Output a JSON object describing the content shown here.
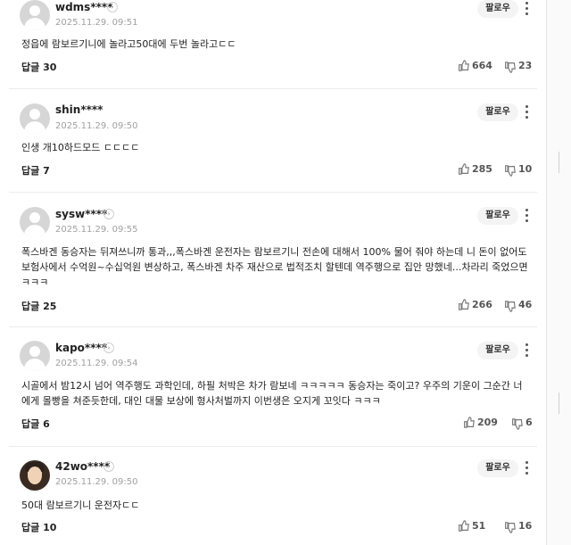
{
  "labels": {
    "follow": "팔로우",
    "reply_prefix": "답글"
  },
  "comments": [
    {
      "user": "wdms****",
      "date": "2025.11.29. 09:51",
      "avatar": "default-avatar",
      "text": "정읍에 람보르기니에 놀라고50대에 두번 놀라고ㄷㄷ",
      "replies": "30",
      "likes": "664",
      "dislikes": "23"
    },
    {
      "user": "shin****",
      "date": "2025.11.29. 09:50",
      "avatar": "default-avatar",
      "text": "인생 개10하드모드 ㄷㄷㄷㄷ",
      "replies": "7",
      "likes": "285",
      "dislikes": "10"
    },
    {
      "user": "sysw****",
      "date": "2025.11.29. 09:55",
      "avatar": "default-avatar",
      "text": "폭스바겐 동승자는 뒤져쓰니까 통과,,,폭스바겐 운전자는 람보르기니 전손에 대해서 100% 물어 줘야 하는데 니 돈이 없어도 보험사에서 수억원~수십억원 변상하고, 폭스바겐 차주 재산으로 법적조치 할텐데 역주행으로 집안 망했네...차라리 죽었으면 ㅋㅋㅋ",
      "replies": "25",
      "likes": "266",
      "dislikes": "46"
    },
    {
      "user": "kapo****",
      "date": "2025.11.29. 09:54",
      "avatar": "default-avatar",
      "text": "시골에서 밤12시 넘어 역주행도 과학인데, 하필 처박은 차가 람보네 ㅋㅋㅋㅋㅋ 동승자는 죽이고? 우주의 기운이 그순간 너에게 몰빵을 쳐준듯한데, 대인 대물 보상에 형사처벌까지 이번생은 오지게 꼬잇다 ㅋㅋㅋ",
      "replies": "6",
      "likes": "209",
      "dislikes": "6"
    },
    {
      "user": "42wo****",
      "date": "2025.11.29. 09:50",
      "avatar": "photo-avatar",
      "text": "50대 람보르기니 운전자ㄷㄷ",
      "replies": "10",
      "likes": "51",
      "dislikes": "16"
    }
  ],
  "icons": {
    "profile": "chevron-right-icon",
    "more": "vertical-dots-icon",
    "like": "thumbs-up-icon",
    "dislike": "thumbs-down-icon"
  },
  "colors": {
    "meta_gray": "#a0a0a0",
    "follow_bg": "#f4f4f4",
    "divider": "#ececec"
  }
}
